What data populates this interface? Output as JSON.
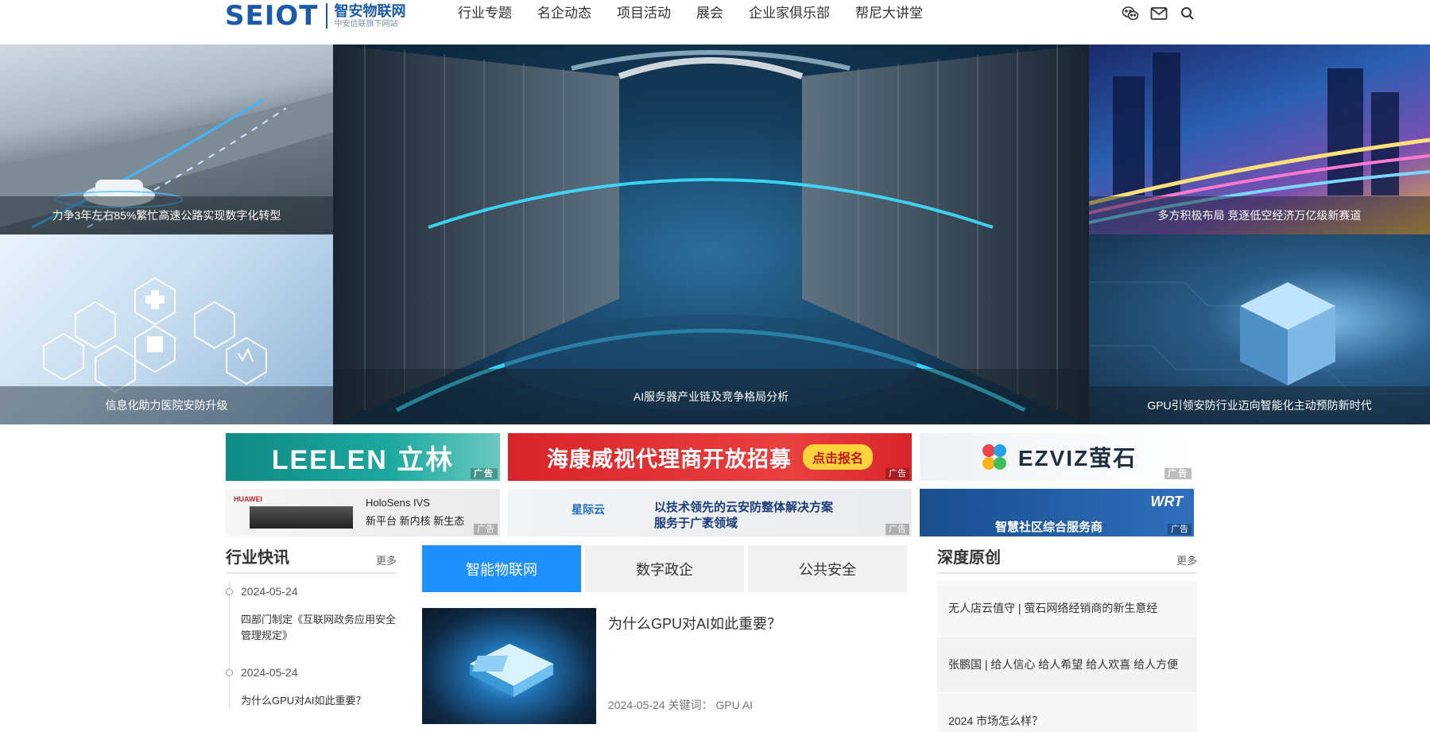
{
  "header": {
    "logo_mark": "SEIOT",
    "logo_name": "智安物联网",
    "logo_sub": "中安信联旗下网站",
    "nav": [
      "行业专题",
      "名企动态",
      "项目活动",
      "展会",
      "企业家俱乐部",
      "帮尼大讲堂"
    ],
    "icons": [
      "wechat-icon",
      "mail-icon",
      "search-icon"
    ]
  },
  "banner": {
    "road": "力争3年左右85%繁忙高速公路实现数字化转型",
    "health": "信息化助力医院安防升级",
    "server": "AI服务器产业链及竞争格局分析",
    "city": "多方积极布局 竞逐低空经济万亿级新赛道",
    "chip": "GPU引领安防行业迈向智能化主动预防新时代"
  },
  "ads": {
    "tag": "广告",
    "leelen": "LEELEN 立林",
    "hik_main": "海康威视代理商开放招募",
    "hik_btn": "点击报名",
    "ezviz": "EZVIZ萤石",
    "huawei_logo": "HUAWEI",
    "huawei_title": "HoloSens IVS",
    "huawei_sub": "新平台  新内核  新生态",
    "star_logo": "星际云",
    "star_line1": "以技术领先的云安防整体解决方案",
    "star_line2": "服务于广袤领域",
    "wrt_text": "智慧社区综合服务商",
    "wrt_logo": "WRT"
  },
  "left": {
    "title": "行业快讯",
    "more": "更多",
    "items": [
      {
        "date": "2024-05-24",
        "text": "四部门制定《互联网政务应用安全管理规定》"
      },
      {
        "date": "2024-05-24",
        "text": "为什么GPU对AI如此重要？"
      }
    ]
  },
  "mid": {
    "tabs": [
      "智能物联网",
      "数字政企",
      "公共安全"
    ],
    "article": {
      "title": "为什么GPU对AI如此重要？",
      "meta": "2024-05-24 关键词： GPU AI"
    }
  },
  "right": {
    "title": "深度原创",
    "more": "更多",
    "items": [
      "无人店云值守 | 萤石网络经销商的新生意经",
      "张鹏国 | 给人信心 给人希望 给人欢喜 给人方便",
      "2024 市场怎么样？"
    ]
  },
  "colors": {
    "brand": "#1a5aa8",
    "active_tab": "#1e90ff"
  }
}
